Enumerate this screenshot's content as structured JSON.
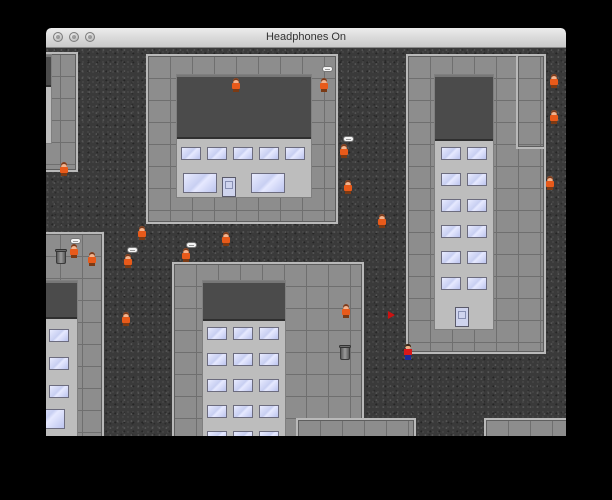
{
  "window": {
    "title": "Headphones On",
    "buttons": [
      "close-button",
      "minimize-button",
      "zoom-button"
    ]
  },
  "game": {
    "terrain": "asphalt",
    "plaza_color": "#8d8d8d",
    "roof_color": "#4b4b4b",
    "wall_color": "#bdbdbd",
    "npc_shirt_color": "#e85a1a",
    "player_shirt_color": "#d81818",
    "player_pants_color": "#1a2a9a",
    "flag_color": "#cc1111"
  }
}
